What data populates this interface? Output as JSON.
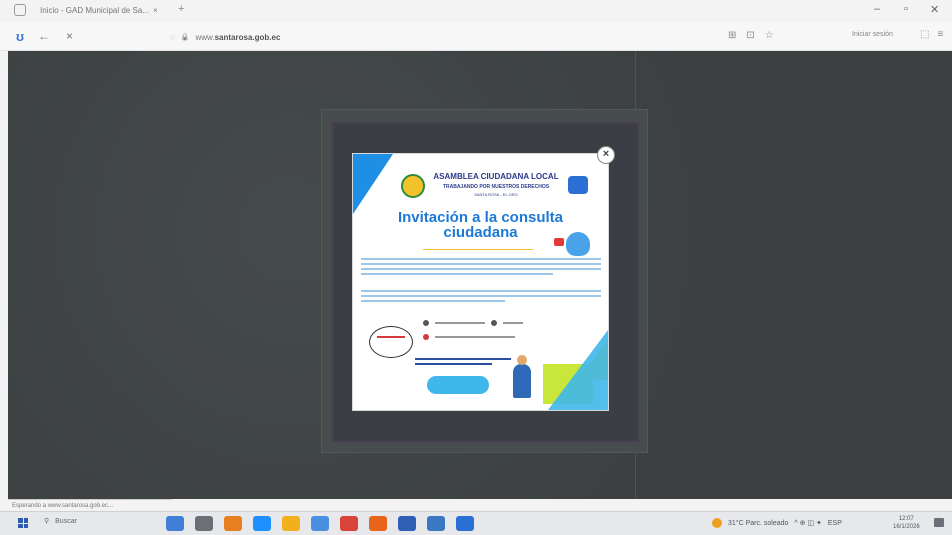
{
  "browser": {
    "tab": {
      "title": "Inicio - GAD Municipal de Sa...",
      "close_icon": "×",
      "new_tab": "+"
    },
    "window_controls": {
      "minimize": "–",
      "maximize": "▫",
      "close": "✕"
    },
    "nav": {
      "logo": "ʊ",
      "back": "←",
      "reload": "×"
    },
    "url": {
      "shield": "◌",
      "lock": "🔒",
      "prefix": "www.",
      "domain": "santarosa.gob.ec"
    },
    "addr_icons": [
      "⊞",
      "⊡",
      "☆"
    ],
    "profile": "Iniciar sesión",
    "right_icons": [
      "⬚",
      "≡"
    ],
    "status_text": "Esperando a www.santarosa.gob.ec..."
  },
  "modal": {
    "close_glyph": "×",
    "org_title": "ASAMBLEA CIUDADANA LOCAL",
    "org_subtitle": "TRABAJANDO POR NUESTROS DERECHOS",
    "org_location": "SANTA ROSA - EL ORO",
    "headline": "Invitación a la consulta ciudadana"
  },
  "taskbar": {
    "search_label": "Buscar",
    "weather": "31°C  Parc. soleado",
    "tray_icons": "^ ⊕ ◫ ✦",
    "lang": "ESP",
    "time": "12:07",
    "date": "16/1/2026",
    "app_colors": [
      "#3f7fd6",
      "#6b6f76",
      "#e67e22",
      "#1e90ff",
      "#f2b01e",
      "#4a90e2",
      "#d9443a",
      "#e8641b",
      "#2f5fb5",
      "#3b78c4",
      "#2a6fd3"
    ]
  }
}
